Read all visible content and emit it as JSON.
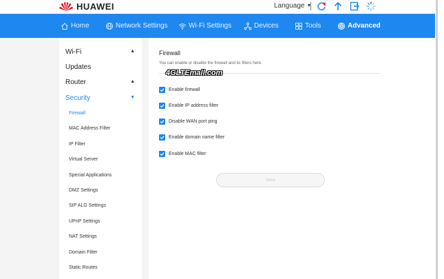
{
  "brand": {
    "name": "HUAWEI"
  },
  "topbar": {
    "language_label": "Language"
  },
  "nav": {
    "items": [
      {
        "label": "Home",
        "icon": "home-icon"
      },
      {
        "label": "Network Settings",
        "icon": "globe-icon"
      },
      {
        "label": "Wi-Fi Settings",
        "icon": "wifi-icon"
      },
      {
        "label": "Devices",
        "icon": "devices-icon"
      },
      {
        "label": "Tools",
        "icon": "tools-icon"
      },
      {
        "label": "Advanced",
        "icon": "gear-icon",
        "active": true
      }
    ]
  },
  "sidebar": {
    "items": [
      {
        "label": "Wi-Fi",
        "expanded": false
      },
      {
        "label": "Updates"
      },
      {
        "label": "Router",
        "expanded": false
      },
      {
        "label": "Security",
        "expanded": true,
        "active": true
      }
    ],
    "security_items": [
      "Firewall",
      "MAC Address Filter",
      "IP Filter",
      "Virtual Server",
      "Special Applications",
      "DMZ Settings",
      "SIP ALG Settings",
      "UPnP Settings",
      "NAT Settings",
      "Domain Filter",
      "Static Routes"
    ],
    "active_item": "Firewall"
  },
  "main": {
    "title": "Firewall",
    "description": "You can enable or disable the firewall and its filters here.",
    "options": [
      {
        "label": "Enable firewall",
        "checked": true
      },
      {
        "label": "Enable IP address filter",
        "checked": true
      },
      {
        "label": "Disable WAN port ping",
        "checked": true
      },
      {
        "label": "Enable domain name filter",
        "checked": true
      },
      {
        "label": "Enable MAC filter",
        "checked": true
      }
    ],
    "save_label": "Save"
  },
  "watermark": "4GLTEmall.com",
  "colors": {
    "accent": "#1e87f0",
    "nav_bg": "#1e87f0",
    "page_bg": "#f4f4f4"
  }
}
